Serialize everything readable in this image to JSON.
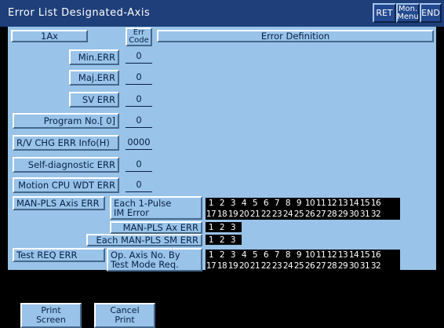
{
  "window": {
    "title": "Error List Designated-Axis",
    "buttons": {
      "ret": "RET",
      "mon_menu": "Mon.\nMenu",
      "end": "END"
    }
  },
  "axis": {
    "selector": "1Ax"
  },
  "header": {
    "err_code": "Err\nCode",
    "error_definition": "Error Definition"
  },
  "rows": {
    "min_err": {
      "label": "Min.ERR",
      "value": "0"
    },
    "maj_err": {
      "label": "Maj.ERR",
      "value": "0"
    },
    "sv_err": {
      "label": "SV ERR",
      "value": "0"
    },
    "program_no": {
      "label": "Program No.[     0]",
      "value": "0"
    },
    "rv_chg": {
      "label": "R/V CHG ERR Info(H)",
      "value": "0000"
    },
    "self_diag": {
      "label": "Self-diagnostic ERR",
      "value": "0"
    },
    "motion_cpu_wdt": {
      "label": "Motion CPU WDT ERR",
      "value": "0"
    }
  },
  "man_pls": {
    "axis_err_label": "MAN-PLS Axis ERR",
    "each_1pulse_label": "Each 1-Pulse\nIM Error",
    "each_1pulse_row1": [
      "1",
      "2",
      "3",
      "4",
      "5",
      "6",
      "7",
      "8",
      "9",
      "10",
      "11",
      "12",
      "13",
      "14",
      "15",
      "16"
    ],
    "each_1pulse_row2": [
      "17",
      "18",
      "19",
      "20",
      "21",
      "22",
      "23",
      "24",
      "25",
      "26",
      "27",
      "28",
      "29",
      "30",
      "31",
      "32"
    ],
    "ax_err_label": "MAN-PLS Ax ERR",
    "ax_err_values": [
      "1",
      "2",
      "3"
    ],
    "sm_err_label": "Each MAN-PLS SM ERR",
    "sm_err_values": [
      "1",
      "2",
      "3"
    ]
  },
  "test_req": {
    "label": "Test REQ ERR",
    "op_axis_label": "Op. Axis No. By\nTest Mode Req.",
    "row1": [
      "1",
      "2",
      "3",
      "4",
      "5",
      "6",
      "7",
      "8",
      "9",
      "10",
      "11",
      "12",
      "13",
      "14",
      "15",
      "16"
    ],
    "row2": [
      "17",
      "18",
      "19",
      "20",
      "21",
      "22",
      "23",
      "24",
      "25",
      "26",
      "27",
      "28",
      "29",
      "30",
      "31",
      "32"
    ]
  },
  "footer": {
    "print_screen": "Print\nScreen",
    "cancel_print": "Cancel\nPrint"
  },
  "colors": {
    "title_bar": "#1e3f7a",
    "panel": "#99c3e8",
    "text": "#08224a"
  }
}
